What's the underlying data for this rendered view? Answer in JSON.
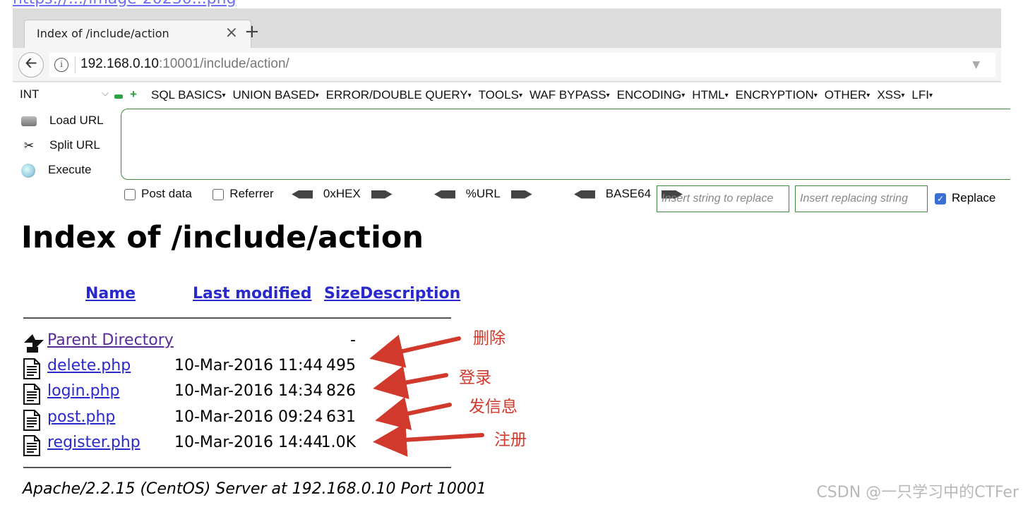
{
  "top_link": "https://.../image-20230...png",
  "browser": {
    "tab_title": "Index of /include/action",
    "tab_close": "×",
    "new_tab": "+",
    "url_host": "192.168.0.10",
    "url_path": ":10001/include/action/"
  },
  "hackbar": {
    "type_select": "INT",
    "menus": [
      "SQL BASICS",
      "UNION BASED",
      "ERROR/DOUBLE QUERY",
      "TOOLS",
      "WAF BYPASS",
      "ENCODING",
      "HTML",
      "ENCRYPTION",
      "OTHER",
      "XSS",
      "LFI"
    ],
    "load_url": "Load URL",
    "split_url": "Split URL",
    "execute": "Execute",
    "post_data": "Post data",
    "referrer": "Referrer",
    "hex": "0xHEX",
    "urlenc": "%URL",
    "base64": "BASE64",
    "replace_placeholder": "Insert string to replace",
    "replacing_placeholder": "Insert replacing string",
    "replace_label": "Replace",
    "replace_checked": true
  },
  "page": {
    "title": "Index of /include/action",
    "columns": {
      "name": "Name",
      "modified": "Last modified",
      "size": "Size",
      "description": "Description"
    },
    "rows": [
      {
        "name": "Parent Directory",
        "date": "",
        "size": "-",
        "icon": "back-folder-icon"
      },
      {
        "name": "delete.php",
        "date": "10-Mar-2016 11:44",
        "size": "495",
        "icon": "file-icon"
      },
      {
        "name": "login.php",
        "date": "10-Mar-2016 14:34",
        "size": "826",
        "icon": "file-icon"
      },
      {
        "name": "post.php",
        "date": "10-Mar-2016 09:24",
        "size": "631",
        "icon": "file-icon"
      },
      {
        "name": "register.php",
        "date": "10-Mar-2016 14:44",
        "size": "1.0K",
        "icon": "file-icon"
      }
    ],
    "footer": "Apache/2.2.15 (CentOS) Server at 192.168.0.10 Port 10001"
  },
  "annotations": [
    "删除",
    "登录",
    "发信息",
    "注册"
  ],
  "annotation_color": "#d0392b",
  "watermark": "CSDN @一只学习中的CTFer"
}
